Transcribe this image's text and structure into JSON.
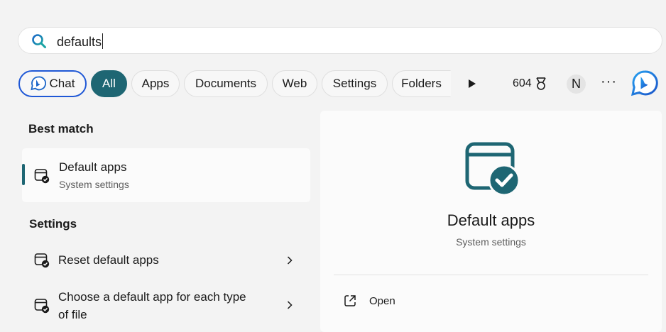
{
  "search": {
    "value": "defaults"
  },
  "filters": {
    "chat": "Chat",
    "all": "All",
    "apps": "Apps",
    "documents": "Documents",
    "web": "Web",
    "settings": "Settings",
    "folders": "Folders"
  },
  "toolbar": {
    "points": "604",
    "avatar_initial": "N",
    "more": "···"
  },
  "best_match": {
    "heading": "Best match",
    "name": "Default apps",
    "subtitle": "System settings"
  },
  "settings_section": {
    "heading": "Settings",
    "items": [
      {
        "label": "Reset default apps"
      },
      {
        "label_line1": "Choose a default app for each type",
        "label_line2": "of file"
      }
    ]
  },
  "preview": {
    "title": "Default apps",
    "subtitle": "System settings",
    "actions": [
      {
        "label": "Open"
      }
    ]
  },
  "colors": {
    "accent": "#1e6673",
    "chat_outline": "#1f58d6",
    "bing_blue": "#1b66c9"
  }
}
